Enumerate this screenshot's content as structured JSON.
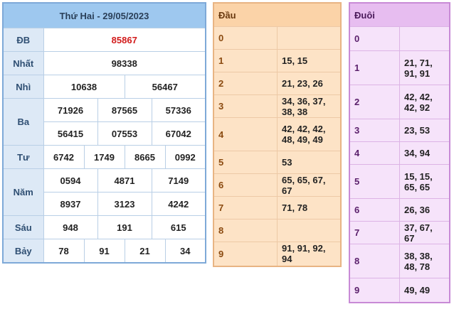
{
  "header": {
    "title": "Thứ Hai - 29/05/2023"
  },
  "prizes": {
    "db": {
      "label": "ĐB",
      "values": [
        "85867"
      ]
    },
    "nhat": {
      "label": "Nhất",
      "values": [
        "98338"
      ]
    },
    "nhi": {
      "label": "Nhì",
      "values": [
        "10638",
        "56467"
      ]
    },
    "ba": {
      "label": "Ba",
      "values": [
        "71926",
        "87565",
        "57336",
        "56415",
        "07553",
        "67042"
      ]
    },
    "tu": {
      "label": "Tư",
      "values": [
        "6742",
        "1749",
        "8665",
        "0992"
      ]
    },
    "nam": {
      "label": "Năm",
      "values": [
        "0594",
        "4871",
        "7149",
        "8937",
        "3123",
        "4242"
      ]
    },
    "sau": {
      "label": "Sáu",
      "values": [
        "948",
        "191",
        "615"
      ]
    },
    "bay": {
      "label": "Bảy",
      "values": [
        "78",
        "91",
        "21",
        "34"
      ]
    }
  },
  "dau": {
    "header": "Đầu",
    "rows": [
      {
        "key": "0",
        "value": ""
      },
      {
        "key": "1",
        "value": "15, 15"
      },
      {
        "key": "2",
        "value": "21, 23, 26"
      },
      {
        "key": "3",
        "value": "34, 36, 37, 38, 38"
      },
      {
        "key": "4",
        "value": "42, 42, 42, 48, 49, 49"
      },
      {
        "key": "5",
        "value": "53"
      },
      {
        "key": "6",
        "value": "65, 65, 67, 67"
      },
      {
        "key": "7",
        "value": "71, 78"
      },
      {
        "key": "8",
        "value": ""
      },
      {
        "key": "9",
        "value": "91, 91, 92, 94"
      }
    ]
  },
  "duoi": {
    "header": "Đuôi",
    "rows": [
      {
        "key": "0",
        "value": ""
      },
      {
        "key": "1",
        "value": "21, 71, 91, 91"
      },
      {
        "key": "2",
        "value": "42, 42, 42, 92"
      },
      {
        "key": "3",
        "value": "23, 53"
      },
      {
        "key": "4",
        "value": "34, 94"
      },
      {
        "key": "5",
        "value": "15, 15, 65, 65"
      },
      {
        "key": "6",
        "value": "26, 36"
      },
      {
        "key": "7",
        "value": "37, 67, 67"
      },
      {
        "key": "8",
        "value": "38, 38, 48, 78"
      },
      {
        "key": "9",
        "value": "49, 49"
      }
    ]
  }
}
